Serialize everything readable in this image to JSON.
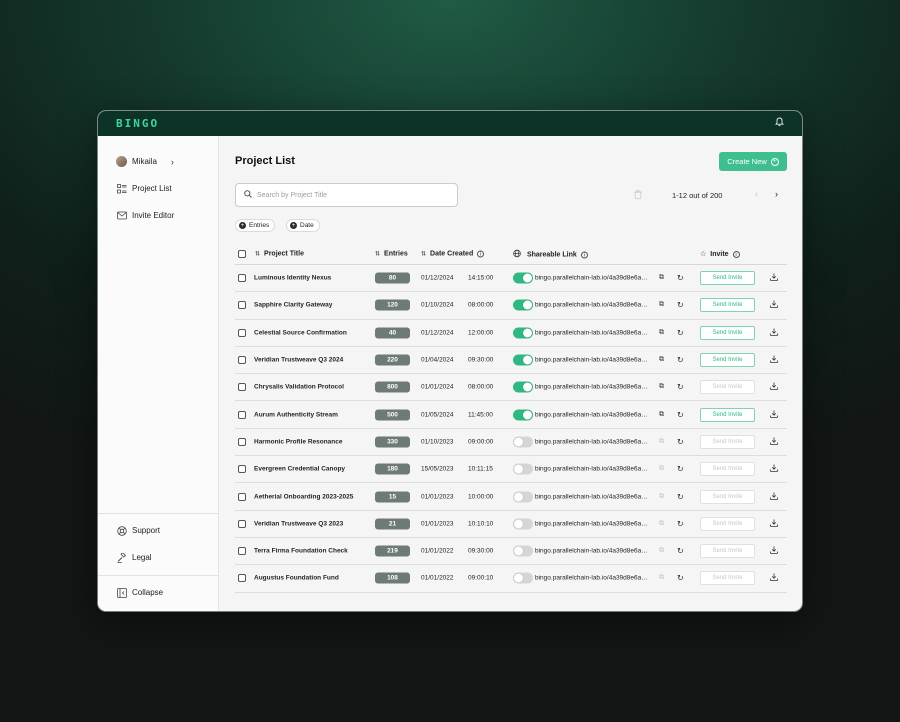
{
  "app": {
    "logo": "BINGO"
  },
  "sidebar": {
    "user": {
      "name": "Mikaila"
    },
    "nav": [
      {
        "label": "Project List",
        "icon": "list-icon"
      },
      {
        "label": "Invite Editor",
        "icon": "mail-icon"
      }
    ],
    "footer": [
      {
        "label": "Support",
        "icon": "lifebuoy-icon"
      },
      {
        "label": "Legal",
        "icon": "gavel-icon"
      }
    ],
    "collapse": {
      "label": "Collapse",
      "icon": "collapse-icon"
    }
  },
  "header": {
    "title": "Project List",
    "create_label": "Create New"
  },
  "search": {
    "placeholder": "Search by Project Title"
  },
  "pagination": {
    "text": "1-12 out of 200"
  },
  "filters": [
    "Entries",
    "Date"
  ],
  "columns": {
    "title": "Project Title",
    "entries": "Entries",
    "date": "Date Created",
    "link": "Shareable Link",
    "invite": "Invite"
  },
  "rows": [
    {
      "title": "Luminous Identity Nexus",
      "entries": "80",
      "date": "01/12/2024",
      "time": "14:15:00",
      "link_on": true,
      "link": "bingo.parallelchain-lab.io/4a39d8e6a…",
      "invite_enabled": true,
      "invite_label": "Send Invite"
    },
    {
      "title": "Sapphire Clarity Gateway",
      "entries": "120",
      "date": "01/10/2024",
      "time": "08:00:00",
      "link_on": true,
      "link": "bingo.parallelchain-lab.io/4a39d8e6a…",
      "invite_enabled": true,
      "invite_label": "Send Invite"
    },
    {
      "title": "Celestial Source Confirmation",
      "entries": "40",
      "date": "01/12/2024",
      "time": "12:00:00",
      "link_on": true,
      "link": "bingo.parallelchain-lab.io/4a39d8e6a…",
      "invite_enabled": true,
      "invite_label": "Send Invite"
    },
    {
      "title": "Veridian Trustweave Q3 2024",
      "entries": "220",
      "date": "01/04/2024",
      "time": "09:30:00",
      "link_on": true,
      "link": "bingo.parallelchain-lab.io/4a39d8e6a…",
      "invite_enabled": true,
      "invite_label": "Send Invite"
    },
    {
      "title": "Chrysalis Validation Protocol",
      "entries": "800",
      "date": "01/01/2024",
      "time": "08:00:00",
      "link_on": true,
      "link": "bingo.parallelchain-lab.io/4a39d8e6a…",
      "invite_enabled": false,
      "invite_label": "Send Invite"
    },
    {
      "title": "Aurum Authenticity Stream",
      "entries": "500",
      "date": "01/05/2024",
      "time": "11:45:00",
      "link_on": true,
      "link": "bingo.parallelchain-lab.io/4a39d8e6a…",
      "invite_enabled": true,
      "invite_label": "Send Invite"
    },
    {
      "title": "Harmonic Profile Resonance",
      "entries": "330",
      "date": "01/10/2023",
      "time": "09:00:00",
      "link_on": false,
      "link": "bingo.parallelchain-lab.io/4a39d8e6a…",
      "invite_enabled": false,
      "invite_label": "Send Invite"
    },
    {
      "title": "Evergreen Credential Canopy",
      "entries": "180",
      "date": "15/05/2023",
      "time": "10:11:15",
      "link_on": false,
      "link": "bingo.parallelchain-lab.io/4a39d8e6a…",
      "invite_enabled": false,
      "invite_label": "Send Invite"
    },
    {
      "title": "Aetherial Onboarding 2023-2025",
      "entries": "15",
      "date": "01/01/2023",
      "time": "10:00:00",
      "link_on": false,
      "link": "bingo.parallelchain-lab.io/4a39d8e6a…",
      "invite_enabled": false,
      "invite_label": "Send Invite"
    },
    {
      "title": "Veridian Trustweave Q3 2023",
      "entries": "21",
      "date": "01/01/2023",
      "time": "10:10:10",
      "link_on": false,
      "link": "bingo.parallelchain-lab.io/4a39d8e6a…",
      "invite_enabled": false,
      "invite_label": "Send Invite"
    },
    {
      "title": "Terra Firma Foundation Check",
      "entries": "219",
      "date": "01/01/2022",
      "time": "09:30:00",
      "link_on": false,
      "link": "bingo.parallelchain-lab.io/4a39d8e6a…",
      "invite_enabled": false,
      "invite_label": "Send Invite"
    },
    {
      "title": "Augustus Foundation Fund",
      "entries": "108",
      "date": "01/01/2022",
      "time": "09:00:10",
      "link_on": false,
      "link": "bingo.parallelchain-lab.io/4a39d8e6a…",
      "invite_enabled": false,
      "invite_label": "Send Invite"
    }
  ],
  "colors": {
    "brand_dark": "#0d3228",
    "accent": "#3fbf8f",
    "toggle_on": "#2fb882",
    "badge": "#6e7a74"
  }
}
